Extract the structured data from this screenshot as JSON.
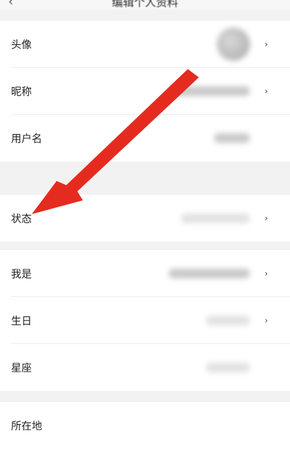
{
  "header": {
    "back_icon": "chevron-left-icon",
    "title": "编辑个人资料"
  },
  "sections": [
    {
      "rows": [
        {
          "label": "头像",
          "kind": "avatar",
          "has_chevron": true
        },
        {
          "label": "昵称",
          "kind": "value",
          "has_chevron": true
        },
        {
          "label": "用户名",
          "kind": "value",
          "has_chevron": false
        }
      ]
    },
    {
      "rows": [
        {
          "label": "状态",
          "kind": "value",
          "has_chevron": true
        }
      ]
    },
    {
      "rows": [
        {
          "label": "我是",
          "kind": "value",
          "has_chevron": true
        },
        {
          "label": "生日",
          "kind": "value",
          "has_chevron": true
        },
        {
          "label": "星座",
          "kind": "value",
          "has_chevron": false
        }
      ]
    },
    {
      "rows": [
        {
          "label": "所在地",
          "kind": "value",
          "has_chevron": false
        }
      ]
    }
  ],
  "chevron_glyph": "›",
  "annotation": {
    "type": "arrow",
    "color": "#e52b1f",
    "points_to": "状态"
  }
}
